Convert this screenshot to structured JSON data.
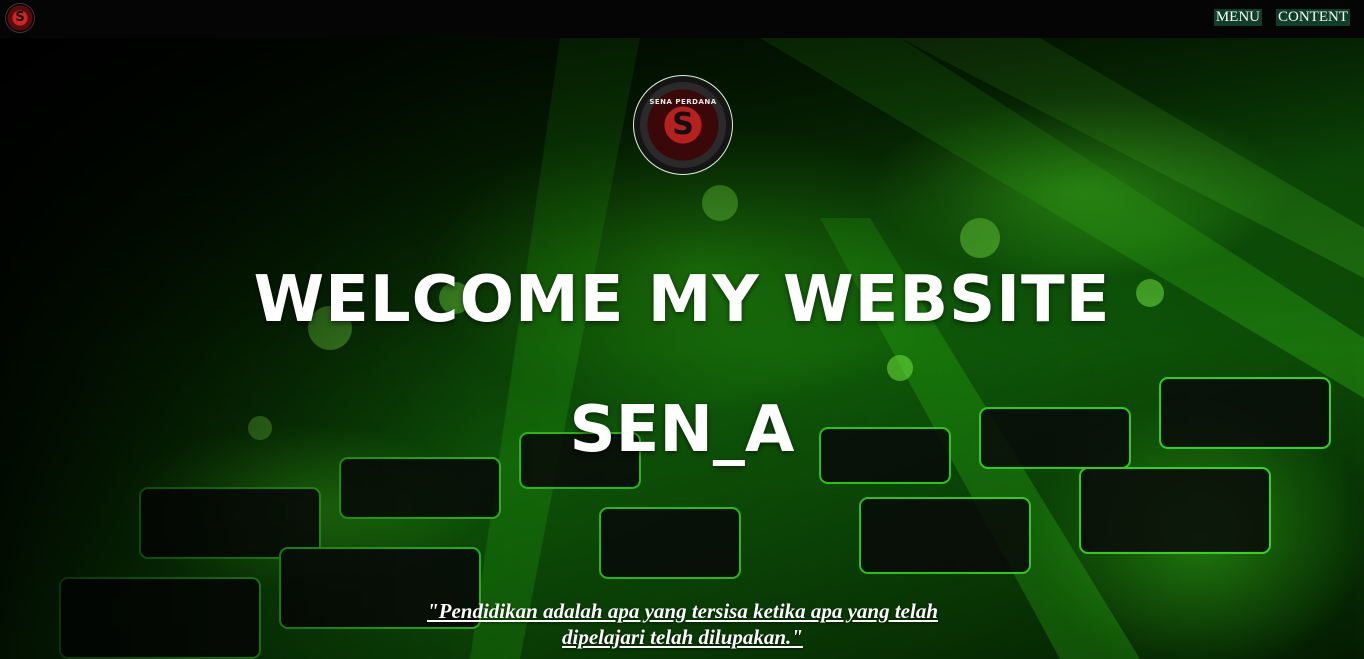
{
  "header": {
    "logo_icon": "sena-logo-icon",
    "nav": [
      {
        "label": "MENU"
      },
      {
        "label": "CONTENT"
      }
    ]
  },
  "hero": {
    "logo_icon": "sena-logo-icon",
    "logo_text": "SENA PERDANA",
    "logo_letter": "S",
    "title": "WELCOME MY WEBSITE",
    "subtitle": "SEN_A",
    "quote": "\"Pendidikan adalah apa yang tersisa ketika apa yang telah dipelajari telah dilupakan.\"",
    "background_icon": "green-keyboard-background"
  },
  "colors": {
    "topbar": "#050505",
    "nav_button_bg": "#0f3f2a",
    "accent_green": "#22cc11",
    "text": "#ffffff"
  }
}
